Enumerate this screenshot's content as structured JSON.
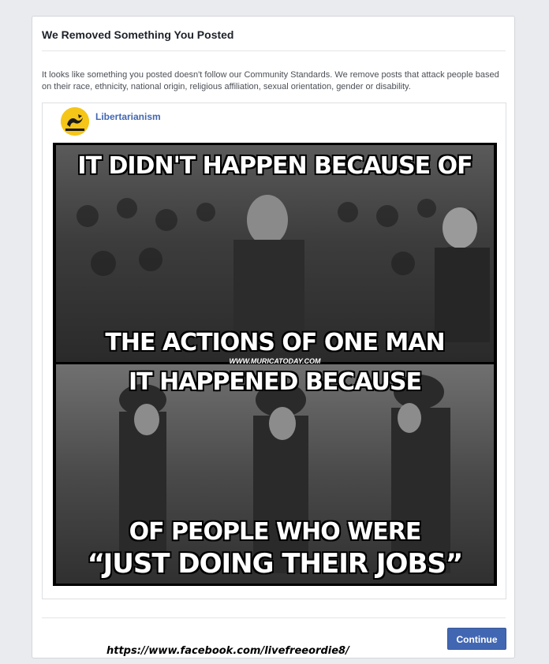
{
  "dialog": {
    "title": "We Removed Something You Posted",
    "message": "It looks like something you posted doesn't follow our Community Standards. We remove posts that attack people based on their race, ethnicity, national origin, religious affiliation, sexual orientation, gender or disability.",
    "continue_label": "Continue"
  },
  "post": {
    "page_name": "Libertarianism",
    "avatar_icon": "snake-flag-icon",
    "avatar_color": "#f5c518",
    "meme": {
      "top_line": "IT DIDN'T HAPPEN BECAUSE OF",
      "middle_line": "THE ACTIONS OF ONE MAN",
      "watermark": "WWW.MURICATODAY.COM",
      "bottom_line1": "IT HAPPENED BECAUSE",
      "bottom_line2": "OF PEOPLE WHO WERE",
      "bottom_line3": "“JUST DOING THEIR JOBS”"
    }
  },
  "footer_url": "https://www.facebook.com/livefreeordie8/",
  "colors": {
    "primary_button": "#4267b2",
    "page_link": "#4267b2",
    "background": "#e9ebee"
  }
}
